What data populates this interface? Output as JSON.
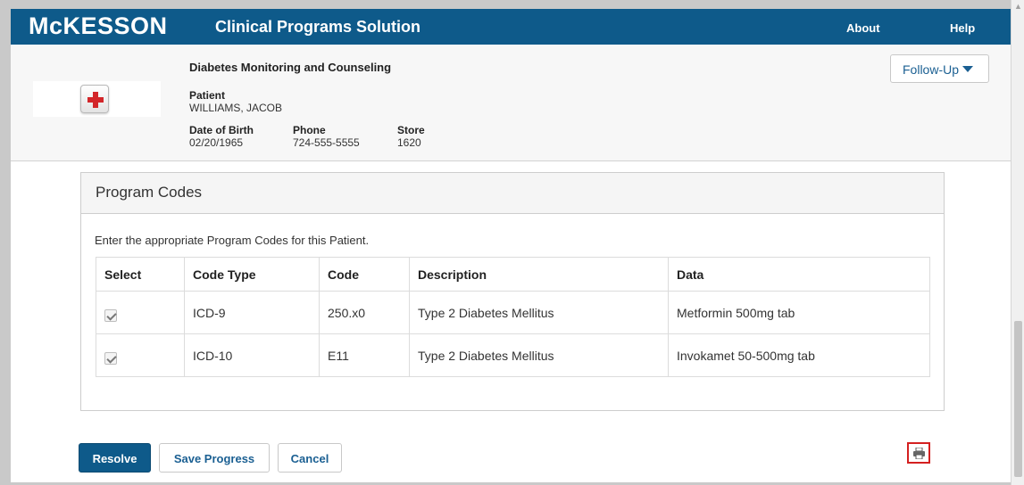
{
  "header": {
    "logo": "McKESSON",
    "app_title": "Clinical Programs Solution",
    "about_label": "About",
    "help_label": "Help"
  },
  "patient": {
    "program_name": "Diabetes Monitoring and Counseling",
    "patient_label": "Patient",
    "patient_name": "WILLIAMS, JACOB",
    "dob_label": "Date of Birth",
    "dob_value": "02/20/1965",
    "phone_label": "Phone",
    "phone_value": "724-555-5555",
    "store_label": "Store",
    "store_value": "1620",
    "followup_label": "Follow-Up",
    "icon": "medical-cross-icon"
  },
  "panel": {
    "title": "Program Codes",
    "instructions": "Enter the appropriate Program Codes for this Patient.",
    "columns": [
      "Select",
      "Code Type",
      "Code",
      "Description",
      "Data"
    ],
    "rows": [
      {
        "selected": true,
        "code_type": "ICD-9",
        "code": "250.x0",
        "description": "Type 2 Diabetes Mellitus",
        "data": "Metformin 500mg tab"
      },
      {
        "selected": true,
        "code_type": "ICD-10",
        "code": "E11",
        "description": "Type 2 Diabetes Mellitus",
        "data": "Invokamet 50-500mg tab"
      }
    ]
  },
  "actions": {
    "resolve_label": "Resolve",
    "save_label": "Save Progress",
    "cancel_label": "Cancel",
    "print_icon": "print-icon"
  },
  "colors": {
    "brand_blue": "#0e5a8a",
    "link_blue": "#1a5f92",
    "highlight_red": "#d42020",
    "cross_red": "#d3262a"
  }
}
